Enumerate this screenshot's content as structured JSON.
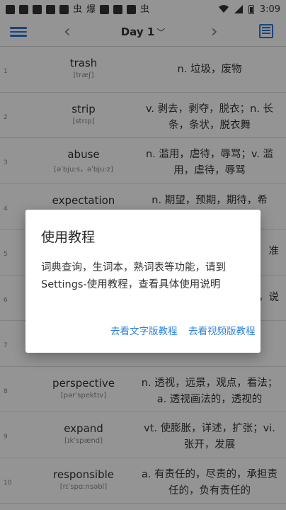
{
  "status_bar": {
    "icons": [
      "虫",
      "爆",
      "虫"
    ],
    "time": "3:09"
  },
  "app_bar": {
    "title": "Day 1",
    "caret": "﹀",
    "prev": "‹",
    "next": "›"
  },
  "words": [
    {
      "num": "1",
      "word": "trash",
      "phonetic": "[træʃ]",
      "definition": "n. 垃圾，废物"
    },
    {
      "num": "2",
      "word": "strip",
      "phonetic": "[strɪp]",
      "definition": "v. 剥去，剥夺，脱衣；n. 长条，条状，脱衣舞"
    },
    {
      "num": "3",
      "word": "abuse",
      "phonetic": "[əˈbjuːs，əˈbjuːz]",
      "definition": "n. 滥用，虐待，辱骂；v. 滥用，虐待，辱骂"
    },
    {
      "num": "4",
      "word": "expectation",
      "phonetic": "",
      "definition": "n. 期望，预期，期待，希"
    },
    {
      "num": "5",
      "word": "",
      "phonetic": "",
      "definition": "准"
    },
    {
      "num": "6",
      "word": "",
      "phonetic": "",
      "definition": "，说"
    },
    {
      "num": "7",
      "word": "",
      "phonetic": "",
      "definition": ""
    },
    {
      "num": "8",
      "word": "perspective",
      "phonetic": "[pərˈspektɪv]",
      "definition": "n. 透视，远景，观点，看法；a. 透视画法的，透视的"
    },
    {
      "num": "9",
      "word": "expand",
      "phonetic": "[ɪkˈspænd]",
      "definition": "vt. 使膨胀，详述，扩张；vi. 张开，发展"
    },
    {
      "num": "10",
      "word": "responsible",
      "phonetic": "[rɪˈspɑːnsəbl]",
      "definition": "a. 有责任的，尽责的，承担责任的，负有责任的"
    }
  ],
  "dialog": {
    "title": "使用教程",
    "message": "词典查询，生词本，熟词表等功能，请到Settings-使用教程，查看具体使用说明",
    "btn_text": "去看文字版教程",
    "btn_video": "去看视频版教程"
  }
}
